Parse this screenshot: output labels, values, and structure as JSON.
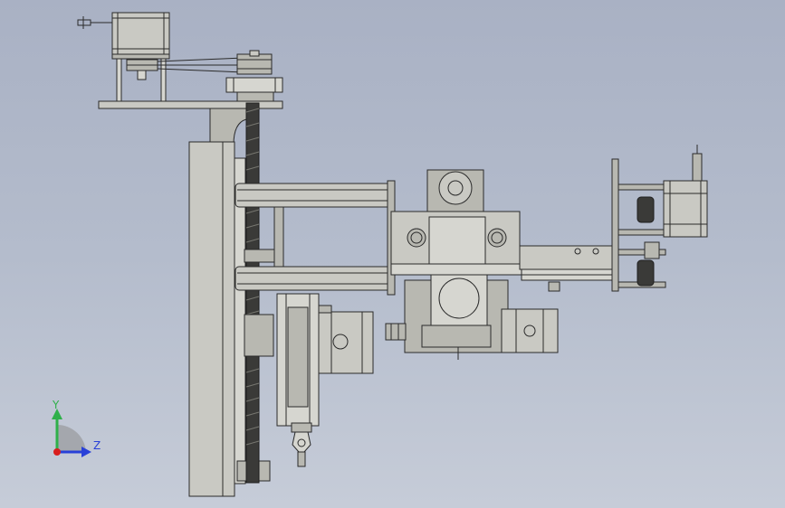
{
  "viewport": {
    "background_top": "#a9b1c4",
    "background_bottom": "#c6ccd8"
  },
  "triad": {
    "y_label": "Y",
    "z_label": "Z",
    "y_color": "#2fb04a",
    "z_color": "#2840d8",
    "x_color": "#d81e1e"
  },
  "colors": {
    "part_fill": "#c9c9c3",
    "part_edge": "#2a2a2a",
    "screw_dark": "#3a3a38"
  }
}
